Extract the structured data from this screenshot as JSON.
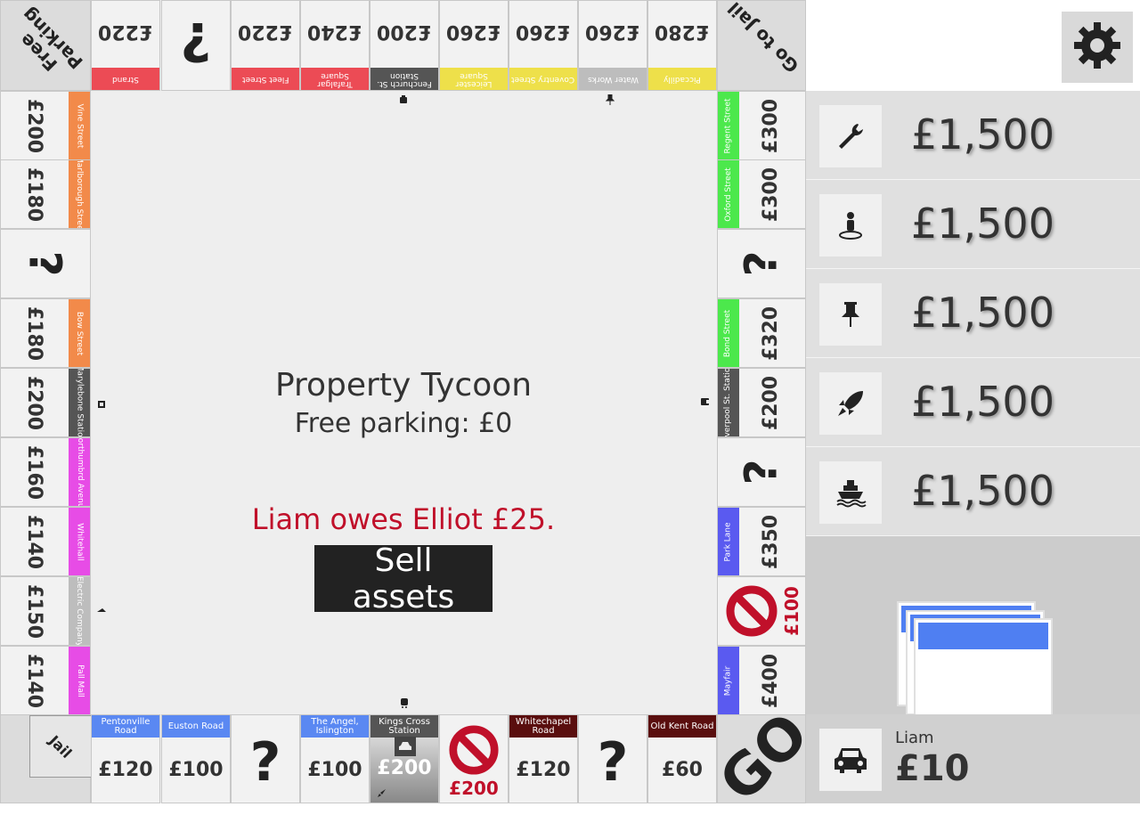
{
  "corners": {
    "free_parking": "Free Parking",
    "go_to_jail": "Go to Jail",
    "jail": "Jail",
    "go": "GO"
  },
  "bottom_row": [
    {
      "name": "Old Kent Road",
      "price": "£60",
      "color": "#5a0e0e"
    },
    {
      "type": "chance"
    },
    {
      "name": "Whitechapel Road",
      "price": "£120",
      "color": "#5a0e0e"
    },
    {
      "type": "tax",
      "price": "£200"
    },
    {
      "name": "Kings Cross Station",
      "price": "£200",
      "color": "#555555",
      "station": true
    },
    {
      "name": "The Angel, Islington",
      "price": "£100",
      "color": "#5a88f2"
    },
    {
      "type": "chance"
    },
    {
      "name": "Euston Road",
      "price": "£100",
      "color": "#5a88f2"
    },
    {
      "name": "Pentonville Road",
      "price": "£120",
      "color": "#5a88f2"
    }
  ],
  "left_col": [
    {
      "name": "Pall Mall",
      "price": "£140",
      "color": "#e74ce6"
    },
    {
      "name": "Electric Company",
      "price": "£150",
      "color": "#bdbdbd"
    },
    {
      "name": "Whitehall",
      "price": "£140",
      "color": "#e74ce6"
    },
    {
      "name": "Northumbrd Avenue",
      "price": "£160",
      "color": "#e74ce6"
    },
    {
      "name": "Marylebone Station",
      "price": "£200",
      "color": "#555555"
    },
    {
      "name": "Bow Street",
      "price": "£180",
      "color": "#f28a4a"
    },
    {
      "type": "chance"
    },
    {
      "name": "Marlborough Street",
      "price": "£180",
      "color": "#f28a4a"
    },
    {
      "name": "Vine Street",
      "price": "£200",
      "color": "#f28a4a"
    }
  ],
  "top_row": [
    {
      "name": "Strand",
      "price": "£220",
      "color": "#ec4b55"
    },
    {
      "type": "chance"
    },
    {
      "name": "Fleet Street",
      "price": "£220",
      "color": "#ec4b55"
    },
    {
      "name": "Trafalgar Square",
      "price": "£240",
      "color": "#ec4b55"
    },
    {
      "name": "Fenchurch St. Station",
      "price": "£200",
      "color": "#555555"
    },
    {
      "name": "Leicester Square",
      "price": "£260",
      "color": "#eee04a"
    },
    {
      "name": "Coventry Street",
      "price": "£260",
      "color": "#eee04a"
    },
    {
      "name": "Water Works",
      "price": "£260",
      "color": "#bdbdbd"
    },
    {
      "name": "Piccadilly",
      "price": "£280",
      "color": "#eee04a"
    }
  ],
  "right_col": [
    {
      "name": "Regent Street",
      "price": "£300",
      "color": "#4ce84c"
    },
    {
      "name": "Oxford Street",
      "price": "£300",
      "color": "#4ce84c"
    },
    {
      "type": "chance"
    },
    {
      "name": "Bond Street",
      "price": "£320",
      "color": "#4ce84c"
    },
    {
      "name": "Liverpool St. Station",
      "price": "£200",
      "color": "#555555"
    },
    {
      "type": "chance"
    },
    {
      "name": "Park Lane",
      "price": "£350",
      "color": "#5a5af0"
    },
    {
      "type": "tax",
      "price": "£100"
    },
    {
      "name": "Mayfair",
      "price": "£400",
      "color": "#5a5af0"
    }
  ],
  "center": {
    "title": "Property Tycoon",
    "free_parking_label": "Free parking: £0",
    "message": "Liam owes Elliot £25.",
    "button": "Sell assets"
  },
  "players": [
    {
      "icon": "wrench-icon",
      "money": "£1,500"
    },
    {
      "icon": "person-icon",
      "money": "£1,500"
    },
    {
      "icon": "pushpin-icon",
      "money": "£1,500"
    },
    {
      "icon": "rocket-icon",
      "money": "£1,500"
    },
    {
      "icon": "ship-icon",
      "money": "£1,500"
    }
  ],
  "current_player": {
    "name": "Liam",
    "money": "£10",
    "icon": "car-icon"
  }
}
